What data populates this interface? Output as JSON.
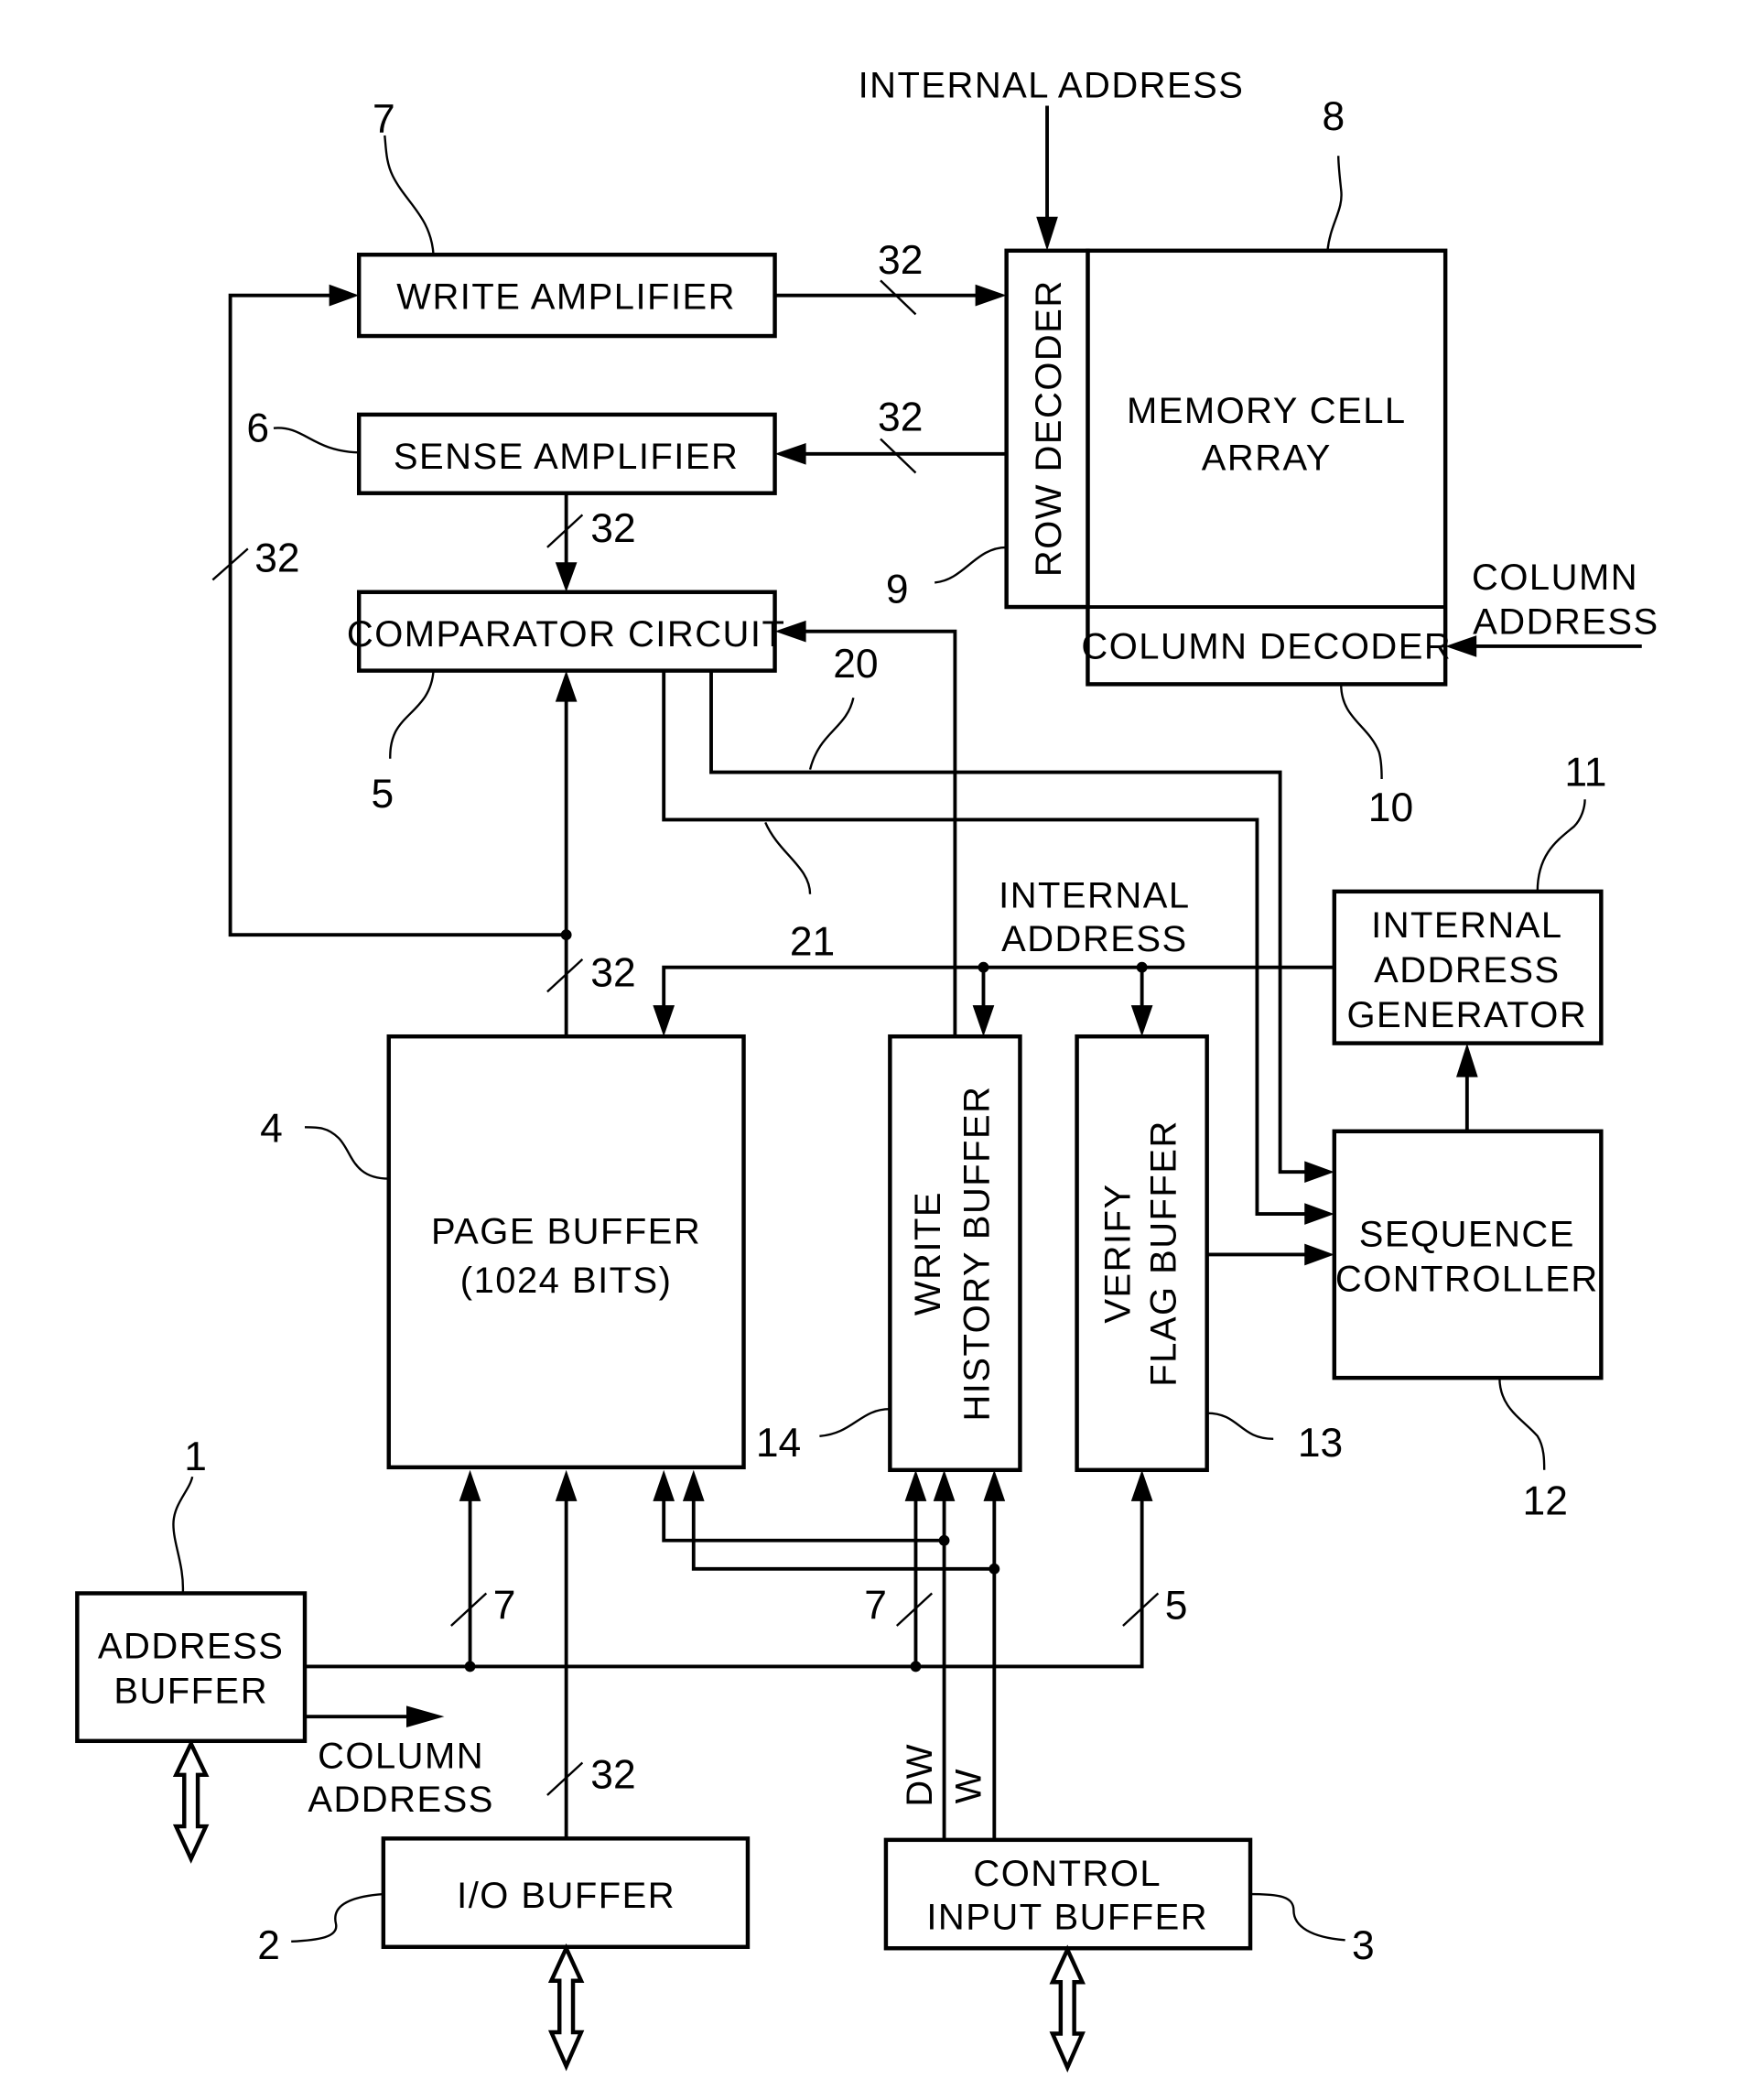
{
  "blocks": {
    "write_amplifier": {
      "label": "WRITE AMPLIFIER",
      "ref": "7"
    },
    "sense_amplifier": {
      "label": "SENSE AMPLIFIER",
      "ref": "6"
    },
    "comparator_circuit": {
      "label": "COMPARATOR CIRCUIT",
      "ref": "5"
    },
    "memory_cell_array": {
      "label_lines": [
        "MEMORY CELL",
        "ARRAY"
      ],
      "ref": "8"
    },
    "row_decoder": {
      "label": "ROW DECODER",
      "ref": "9"
    },
    "column_decoder": {
      "label": "COLUMN DECODER",
      "ref": "10"
    },
    "internal_address_generator": {
      "label_lines": [
        "INTERNAL",
        "ADDRESS",
        "GENERATOR"
      ],
      "ref": "11"
    },
    "sequence_controller": {
      "label_lines": [
        "SEQUENCE",
        "CONTROLLER"
      ],
      "ref": "12"
    },
    "verify_flag_buffer": {
      "label_lines": [
        "VERIFY",
        "FLAG BUFFER"
      ],
      "ref": "13"
    },
    "write_history_buffer": {
      "label_lines": [
        "WRITE",
        "HISTORY BUFFER"
      ],
      "ref": "14"
    },
    "page_buffer": {
      "label_lines": [
        "PAGE BUFFER",
        "(1024 BITS)"
      ],
      "ref": "4"
    },
    "address_buffer": {
      "label_lines": [
        "ADDRESS",
        "BUFFER"
      ],
      "ref": "1"
    },
    "io_buffer": {
      "label": "I/O BUFFER",
      "ref": "2"
    },
    "control_input_buffer": {
      "label_lines": [
        "CONTROL",
        "INPUT BUFFER"
      ],
      "ref": "3"
    }
  },
  "signals": {
    "internal_address_top": "INTERNAL ADDRESS",
    "internal_address_mid": [
      "INTERNAL",
      "ADDRESS"
    ],
    "column_address_right": [
      "COLUMN",
      "ADDRESS"
    ],
    "column_address_left": [
      "COLUMN",
      "ADDRESS"
    ],
    "line_20": "20",
    "line_21": "21",
    "dw": "DW",
    "w": "W"
  },
  "bus_widths": {
    "wa_to_array": "32",
    "array_to_sa": "32",
    "sa_to_comp": "32",
    "feedback_loop": "32",
    "page_out": "32",
    "io_in": "32",
    "addr_to_page": "7",
    "addr_to_whb": "7",
    "addr_to_vfb": "5"
  }
}
